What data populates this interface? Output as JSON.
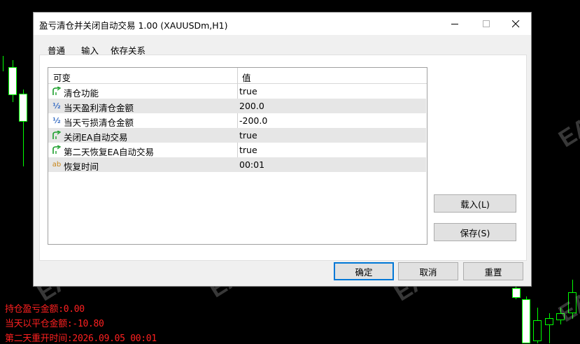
{
  "dialog": {
    "title": "盈亏清仓并关闭自动交易 1.00 (XAUUSDm,H1)",
    "tabs": [
      {
        "label": "普通",
        "active": false
      },
      {
        "label": "输入",
        "active": true
      },
      {
        "label": "依存关系",
        "active": false
      }
    ],
    "grid": {
      "col_variable": "可变",
      "col_value": "值",
      "rows": [
        {
          "icon": "toggle-arrow-icon",
          "name": "清仓功能",
          "value": "true"
        },
        {
          "icon": "fraction-icon",
          "name": "当天盈利清仓金额",
          "value": "200.0"
        },
        {
          "icon": "fraction-icon",
          "name": "当天亏损清仓金额",
          "value": "-200.0"
        },
        {
          "icon": "toggle-arrow-icon",
          "name": "关闭EA自动交易",
          "value": "true"
        },
        {
          "icon": "toggle-arrow-icon",
          "name": "第二天恢复EA自动交易",
          "value": "true"
        },
        {
          "icon": "ab-text-icon",
          "name": "恢复时间",
          "value": "00:01"
        }
      ]
    },
    "buttons": {
      "load": "载入(L)",
      "save": "保存(S)",
      "ok": "确定",
      "cancel": "取消",
      "reset": "重置"
    }
  },
  "chart": {
    "watermark": "EAHub.cn",
    "info": [
      "持仓盈亏金额:0.00",
      "当天以平仓金额:-10.80",
      "第二天重开时间:2026.09.05 00:01"
    ],
    "colors": {
      "candle": "#00ff00",
      "info_text": "#ff2020",
      "background": "#000000"
    }
  }
}
